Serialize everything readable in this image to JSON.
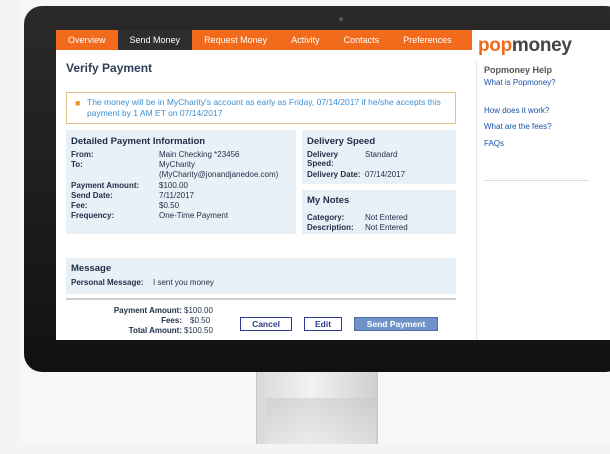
{
  "nav": {
    "tabs": [
      {
        "label": "Overview",
        "active": false
      },
      {
        "label": "Send Money",
        "active": true
      },
      {
        "label": "Request Money",
        "active": false
      },
      {
        "label": "Activity",
        "active": false
      },
      {
        "label": "Contacts",
        "active": false
      },
      {
        "label": "Preferences",
        "active": false
      }
    ]
  },
  "brand": {
    "logo_part1": "pop",
    "logo_part2": "money",
    "accent_color": "#f26b1d"
  },
  "sidebar": {
    "title": "Popmoney Help",
    "links": [
      "What is Popmoney?",
      "How does it work?",
      "What are the fees?",
      "FAQs"
    ]
  },
  "page": {
    "title": "Verify Payment",
    "notice": "The money will be in MyCharity's account as early as Friday, 07/14/2017 if he/she accepts this payment by 1 AM ET on 07/14/2017"
  },
  "details": {
    "title": "Detailed Payment Information",
    "from_label": "From:",
    "from_value": "Main Checking *23456",
    "to_label": "To:",
    "to_value_line1": "MyCharity",
    "to_value_line2": "(MyCharity@jonandjanedoe.com)",
    "amount_label": "Payment Amount:",
    "amount_value": "$100.00",
    "send_date_label": "Send Date:",
    "send_date_value": "7/11/2017",
    "fee_label": "Fee:",
    "fee_value": "$0.50",
    "frequency_label": "Frequency:",
    "frequency_value": "One-Time Payment"
  },
  "delivery": {
    "title": "Delivery Speed",
    "speed_label_line1": "Delivery",
    "speed_label_line2": "Speed:",
    "speed_value": "Standard",
    "date_label": "Delivery Date:",
    "date_value": "07/14/2017"
  },
  "notes": {
    "title": "My Notes",
    "category_label": "Category:",
    "category_value": "Not Entered",
    "description_label": "Description:",
    "description_value": "Not Entered"
  },
  "message": {
    "title": "Message",
    "personal_label": "Personal Message:",
    "personal_value": "I sent you money"
  },
  "totals": {
    "payment_amount_label": "Payment Amount:",
    "payment_amount_value": "$100.00",
    "fees_label": "Fees:",
    "fees_value": "$0.50",
    "total_label": "Total Amount:",
    "total_value": "$100.50"
  },
  "actions": {
    "cancel": "Cancel",
    "edit": "Edit",
    "send": "Send Payment"
  }
}
